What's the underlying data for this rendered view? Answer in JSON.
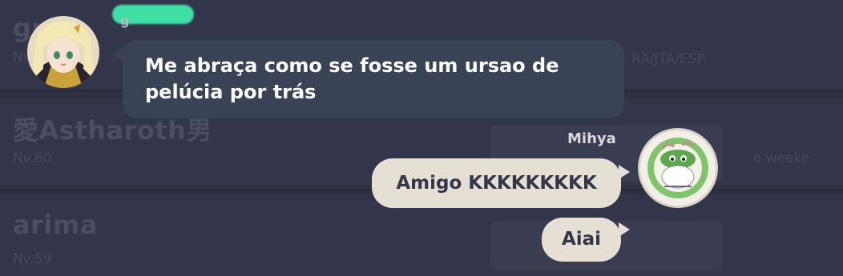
{
  "background_list": {
    "rows": [
      {
        "name": "gr",
        "meta": "Nv."
      },
      {
        "name": "愛Astharoth男",
        "meta": "Nv.60"
      },
      {
        "name": "arima",
        "meta": "Nv.59"
      }
    ],
    "right_meta": [
      "RA/JTA/ESP",
      "e weeke"
    ]
  },
  "chat": {
    "messages": [
      {
        "sender": "g",
        "direction": "incoming",
        "text_line1": "Me abraça como se fosse um ursao de",
        "text_line2": "pelúcia  por trás"
      },
      {
        "sender": "Mihya",
        "direction": "outgoing",
        "text": "Amigo KKKKKKKKK"
      },
      {
        "sender": "Mihya",
        "direction": "outgoing",
        "text": "Aiai"
      }
    ]
  },
  "colors": {
    "background": "#2f3042",
    "incoming_bubble": "#3a4255",
    "outgoing_bubble": "#e6dfd3",
    "censor_blob": "#3fe0a6"
  }
}
